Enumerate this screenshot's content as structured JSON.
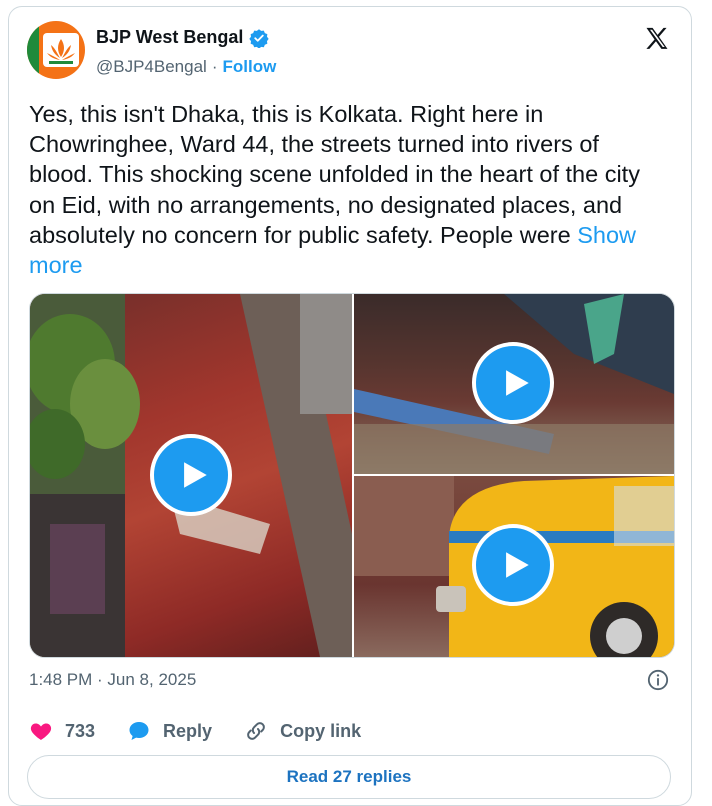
{
  "author": {
    "name": "BJP West Bengal",
    "handle": "@BJP4Bengal",
    "separator": "·",
    "follow_label": "Follow"
  },
  "tweet": {
    "text": "Yes, this isn't Dhaka, this is Kolkata. Right here in Chowringhee, Ward 44, the streets turned into rivers of blood. This shocking scene unfolded in the heart of the city on Eid, with no arrangements, no designated places, and absolutely no concern for public safety. People were ",
    "show_more_label": "Show more"
  },
  "media": [
    {
      "type": "video"
    },
    {
      "type": "video"
    },
    {
      "type": "video"
    }
  ],
  "timestamp": "1:48 PM · Jun 8, 2025",
  "actions": {
    "likes_count": "733",
    "reply_label": "Reply",
    "copy_link_label": "Copy link"
  },
  "replies_button_label": "Read 27 replies",
  "colors": {
    "accent": "#1d9bf0",
    "like": "#f91880",
    "text_secondary": "#536471"
  },
  "icons": [
    "bjp-logo-avatar",
    "verified-badge-icon",
    "x-logo-icon",
    "play-icon",
    "info-icon",
    "heart-icon",
    "reply-bubble-icon",
    "link-icon"
  ]
}
